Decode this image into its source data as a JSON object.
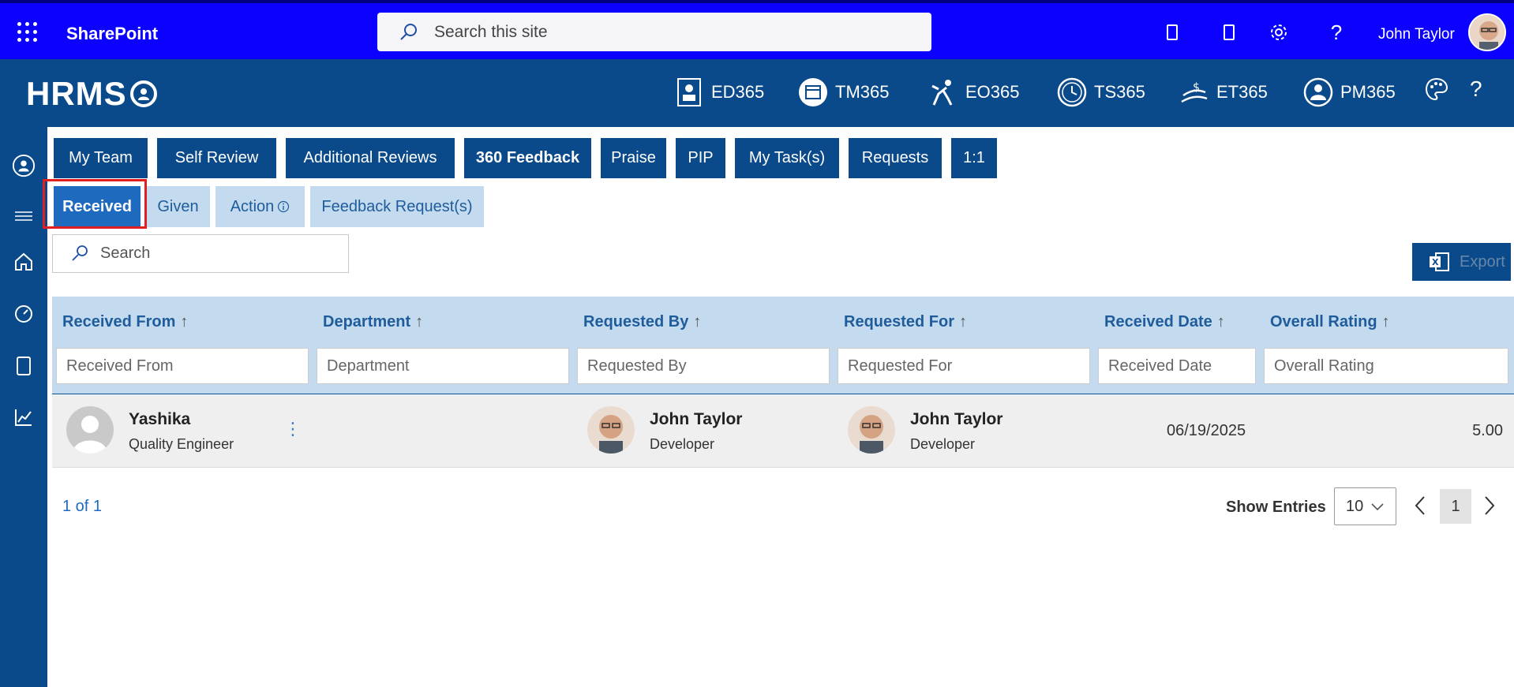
{
  "suite_bar": {
    "app_name": "SharePoint",
    "search_placeholder": "Search this site",
    "user_name": "John Taylor"
  },
  "hrms": {
    "logo_text": "HRMS",
    "apps": [
      {
        "label": "ED365",
        "icon": "directory-icon"
      },
      {
        "label": "TM365",
        "icon": "calendar-icon"
      },
      {
        "label": "EO365",
        "icon": "onboarding-icon"
      },
      {
        "label": "TS365",
        "icon": "clock-icon"
      },
      {
        "label": "ET365",
        "icon": "expense-icon"
      },
      {
        "label": "PM365",
        "icon": "performance-icon"
      }
    ]
  },
  "tabs_primary": [
    "My Team",
    "Self Review",
    "Additional Reviews",
    "360 Feedback",
    "Praise",
    "PIP",
    "My Task(s)",
    "Requests",
    "1:1"
  ],
  "tabs_primary_active": "360 Feedback",
  "tabs_secondary": [
    "Received",
    "Given",
    "Action",
    "Feedback Request(s)"
  ],
  "tabs_secondary_active": "Received",
  "search": {
    "placeholder": "Search"
  },
  "export_label": "Export",
  "grid": {
    "columns": [
      "Received From",
      "Department",
      "Requested By",
      "Requested For",
      "Received Date",
      "Overall Rating"
    ],
    "filters": [
      "Received From",
      "Department",
      "Requested By",
      "Requested For",
      "Received Date",
      "Overall Rating"
    ],
    "rows": [
      {
        "from_name": "Yashika",
        "from_title": "Quality Engineer",
        "department": "",
        "requested_by_name": "John Taylor",
        "requested_by_title": "Developer",
        "requested_for_name": "John Taylor",
        "requested_for_title": "Developer",
        "received_date": "06/19/2025",
        "overall_rating": "5.00"
      }
    ]
  },
  "pager": {
    "info": "1 of 1",
    "show_entries_label": "Show Entries",
    "entries_value": "10",
    "current_page": "1"
  },
  "colors": {
    "suite_bar": "#0c00ff",
    "hrms_bar": "#0a4a8a",
    "secondary_tab": "#c4daee",
    "active_secondary_tab": "#1e6abf",
    "highlight": "#e02020"
  }
}
